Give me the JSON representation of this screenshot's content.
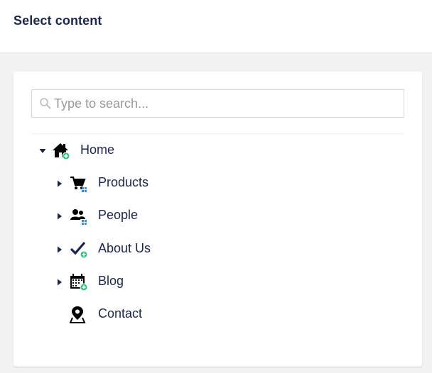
{
  "header": {
    "title": "Select content"
  },
  "search": {
    "placeholder": "Type to search...",
    "value": "",
    "icon": "search-icon"
  },
  "tree": {
    "root": {
      "label": "Home",
      "icon": "home-icon",
      "expanded": true
    },
    "children": [
      {
        "label": "Products",
        "icon": "shopping-cart-icon",
        "has_children": true
      },
      {
        "label": "People",
        "icon": "people-icon",
        "has_children": true
      },
      {
        "label": "About Us",
        "icon": "checkmark-icon",
        "has_children": true
      },
      {
        "label": "Blog",
        "icon": "calendar-icon",
        "has_children": true
      },
      {
        "label": "Contact",
        "icon": "map-pin-icon",
        "has_children": false
      }
    ]
  },
  "colors": {
    "text": "#1b264f",
    "background": "#f3f2f2",
    "badge_green": "#2bc37c",
    "badge_blue": "#3544b1"
  }
}
